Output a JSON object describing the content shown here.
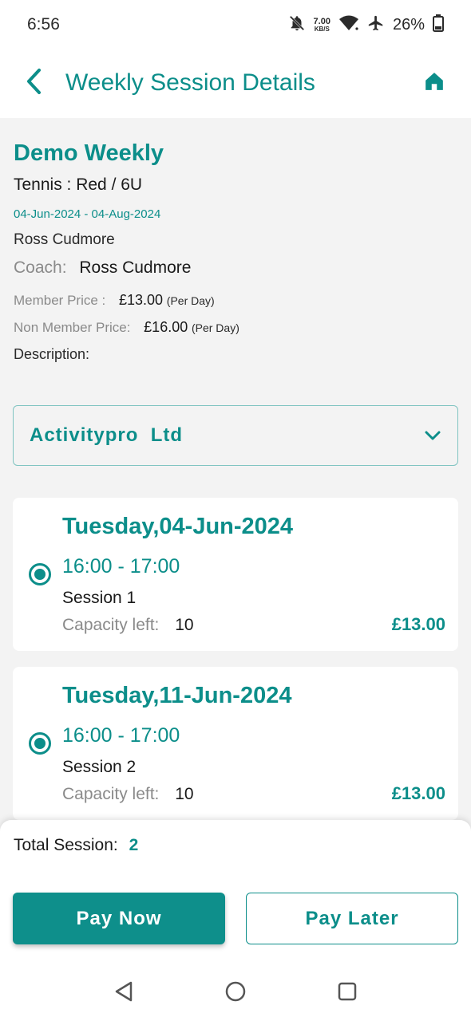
{
  "status_bar": {
    "time": "6:56",
    "net_speed_value": "7.00",
    "net_speed_unit": "KB/S",
    "battery": "26%",
    "icons": [
      "bell-off-icon",
      "wifi-icon",
      "airplane-icon",
      "battery-icon"
    ]
  },
  "header": {
    "title": "Weekly Session Details",
    "back_icon": "chevron-left-icon",
    "home_icon": "home-icon"
  },
  "program": {
    "title": "Demo Weekly",
    "sport_line": "Tennis : Red / 6U",
    "date_range": "04-Jun-2024 - 04-Aug-2024",
    "organizer": "Ross Cudmore",
    "coach_label": "Coach:",
    "coach_name": "Ross Cudmore",
    "member_price_label": "Member Price :",
    "member_price": "£13.00",
    "member_price_unit": "(Per Day)",
    "non_member_price_label": "Non Member Price:",
    "non_member_price": "£16.00",
    "non_member_price_unit": "(Per Day)",
    "description_label": "Description:"
  },
  "venue_select": {
    "value": "Activitypro  Ltd",
    "icon": "chevron-down-icon"
  },
  "sessions": [
    {
      "date": "Tuesday,04-Jun-2024",
      "time": "16:00 - 17:00",
      "name": "Session 1",
      "capacity_label": "Capacity left:",
      "capacity": "10",
      "price": "£13.00",
      "selected": true
    },
    {
      "date": "Tuesday,11-Jun-2024",
      "time": "16:00 - 17:00",
      "name": "Session 2",
      "capacity_label": "Capacity left:",
      "capacity": "10",
      "price": "£13.00",
      "selected": true
    }
  ],
  "footer": {
    "total_label": "Total Session:",
    "total_count": "2",
    "pay_now": "Pay Now",
    "pay_later": "Pay Later"
  },
  "colors": {
    "brand": "#0c8e8a",
    "button": "#0e8f8b",
    "background": "#f3f3f3"
  },
  "nav_bar": {
    "icons": [
      "back-triangle-icon",
      "home-circle-icon",
      "recents-square-icon"
    ]
  }
}
